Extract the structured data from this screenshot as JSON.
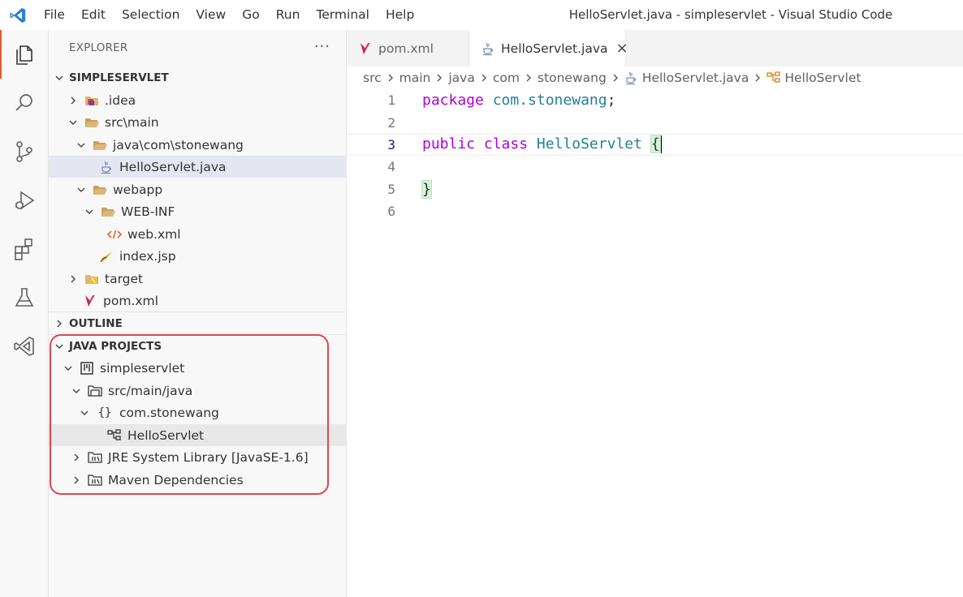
{
  "menu": [
    "File",
    "Edit",
    "Selection",
    "View",
    "Go",
    "Run",
    "Terminal",
    "Help"
  ],
  "window_title": "HelloServlet.java - simpleservlet - Visual Studio Code",
  "activity_bar": [
    "explorer-icon",
    "search-icon",
    "source-control-icon",
    "run-debug-icon",
    "extensions-icon",
    "testing-icon",
    "remote-explorer-icon"
  ],
  "explorer": {
    "title": "EXPLORER",
    "more": "···",
    "root": "SIMPLESERVLET",
    "items": [
      {
        "label": ".idea"
      },
      {
        "label": "src\\main"
      },
      {
        "label": "java\\com\\stonewang"
      },
      {
        "label": "HelloServlet.java"
      },
      {
        "label": "webapp"
      },
      {
        "label": "WEB-INF"
      },
      {
        "label": "web.xml"
      },
      {
        "label": "index.jsp"
      },
      {
        "label": "target"
      },
      {
        "label": "pom.xml"
      }
    ]
  },
  "outline": {
    "title": "OUTLINE"
  },
  "java_projects": {
    "title": "JAVA PROJECTS",
    "items": [
      {
        "label": "simpleservlet"
      },
      {
        "label": "src/main/java"
      },
      {
        "label": "com.stonewang"
      },
      {
        "label": "HelloServlet"
      },
      {
        "label": "JRE System Library [JavaSE-1.6]"
      },
      {
        "label": "Maven Dependencies"
      }
    ]
  },
  "tabs": [
    {
      "label": "pom.xml"
    },
    {
      "label": "HelloServlet.java",
      "close": "×"
    }
  ],
  "breadcrumb": [
    "src",
    "main",
    "java",
    "com",
    "stonewang",
    "HelloServlet.java",
    "HelloServlet"
  ],
  "editor": {
    "line_numbers": [
      "1",
      "2",
      "3",
      "4",
      "5",
      "6"
    ],
    "line1": {
      "kw": "package",
      "ns": "com.stonewang",
      "punct": ";"
    },
    "line3": {
      "kw1": "public",
      "kw2": "class",
      "cls": "HelloServlet",
      "brace": "{"
    },
    "line5": {
      "brace": "}"
    }
  },
  "colors": {
    "accent": "#e25a2b",
    "highlight_box": "#e0474c",
    "keyword": "#af00db",
    "type": "#267f99"
  }
}
